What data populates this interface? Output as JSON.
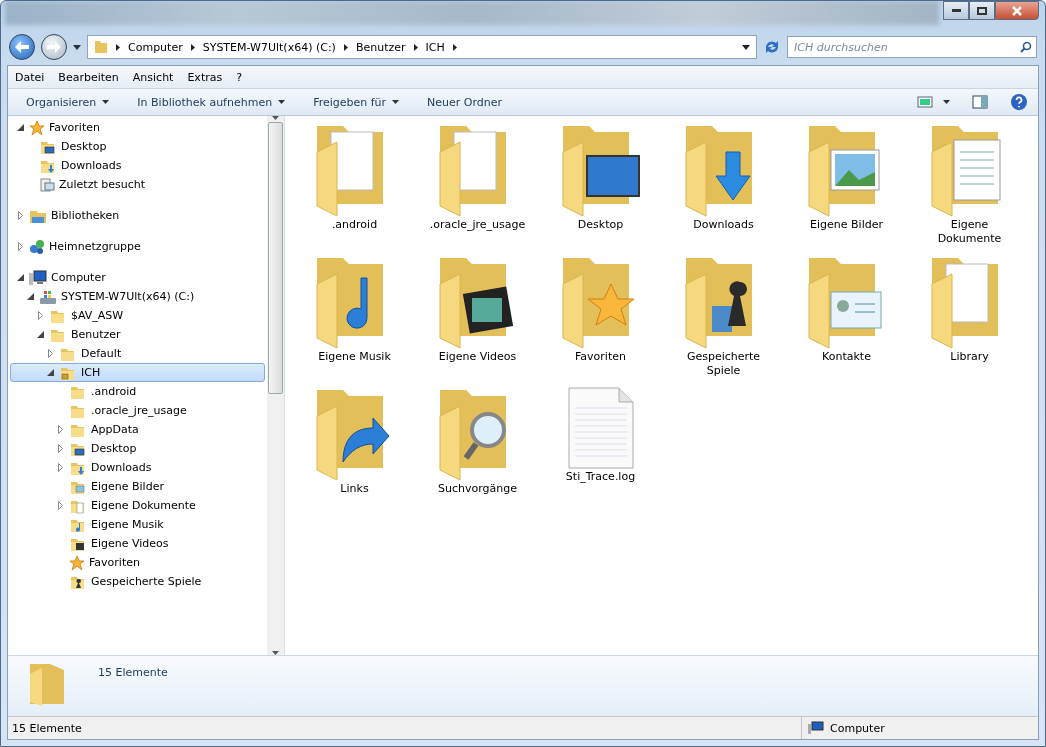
{
  "address": {
    "crumbs": [
      "Computer",
      "SYSTEM-W7Ult(x64) (C:)",
      "Benutzer",
      "ICH"
    ]
  },
  "search": {
    "placeholder": "ICH durchsuchen"
  },
  "menu": [
    "Datei",
    "Bearbeiten",
    "Ansicht",
    "Extras",
    "?"
  ],
  "commands": [
    {
      "label": "Organisieren",
      "dropdown": true
    },
    {
      "label": "In Bibliothek aufnehmen",
      "dropdown": true
    },
    {
      "label": "Freigeben für",
      "dropdown": true
    },
    {
      "label": "Neuer Ordner",
      "dropdown": false
    }
  ],
  "sidebar": {
    "items": [
      {
        "label": "Favoriten",
        "kind": "star",
        "expandable": true,
        "expanded": true,
        "selected": false,
        "children": [
          {
            "label": "Desktop",
            "kind": "monitor",
            "expandable": false,
            "selected": false
          },
          {
            "label": "Downloads",
            "kind": "download",
            "expandable": false,
            "selected": false
          },
          {
            "label": "Zuletzt besucht",
            "kind": "recent",
            "expandable": false,
            "selected": false
          }
        ]
      },
      {
        "label": "Bibliotheken",
        "kind": "library",
        "expandable": true,
        "expanded": false,
        "selected": false
      },
      {
        "label": "Heimnetzgruppe",
        "kind": "network",
        "expandable": true,
        "expanded": false,
        "selected": false
      },
      {
        "label": "Computer",
        "kind": "computer",
        "expandable": true,
        "expanded": true,
        "selected": false,
        "children": [
          {
            "label": "SYSTEM-W7Ult(x64) (C:)",
            "kind": "drive",
            "expandable": true,
            "expanded": true,
            "selected": false,
            "children": [
              {
                "label": "$AV_ASW",
                "kind": "folder",
                "expandable": true,
                "expanded": false,
                "selected": false
              },
              {
                "label": "Benutzer",
                "kind": "folder",
                "expandable": true,
                "expanded": true,
                "selected": false,
                "children": [
                  {
                    "label": "Default",
                    "kind": "folder",
                    "expandable": true,
                    "expanded": false,
                    "selected": false
                  },
                  {
                    "label": "ICH",
                    "kind": "user",
                    "expandable": true,
                    "expanded": true,
                    "selected": true,
                    "children": [
                      {
                        "label": ".android",
                        "kind": "folder",
                        "expandable": false,
                        "selected": false
                      },
                      {
                        "label": ".oracle_jre_usage",
                        "kind": "folder",
                        "expandable": false,
                        "selected": false
                      },
                      {
                        "label": "AppData",
                        "kind": "folder",
                        "expandable": true,
                        "expanded": false,
                        "selected": false
                      },
                      {
                        "label": "Desktop",
                        "kind": "monitor",
                        "expandable": true,
                        "expanded": false,
                        "selected": false
                      },
                      {
                        "label": "Downloads",
                        "kind": "download",
                        "expandable": true,
                        "expanded": false,
                        "selected": false
                      },
                      {
                        "label": "Eigene Bilder",
                        "kind": "pictures",
                        "expandable": false,
                        "selected": false
                      },
                      {
                        "label": "Eigene Dokumente",
                        "kind": "documents",
                        "expandable": true,
                        "expanded": false,
                        "selected": false
                      },
                      {
                        "label": "Eigene Musik",
                        "kind": "music",
                        "expandable": false,
                        "selected": false
                      },
                      {
                        "label": "Eigene Videos",
                        "kind": "videos",
                        "expandable": false,
                        "selected": false
                      },
                      {
                        "label": "Favoriten",
                        "kind": "star",
                        "expandable": false,
                        "selected": false
                      },
                      {
                        "label": "Gespeicherte Spiele",
                        "kind": "games",
                        "expandable": false,
                        "selected": false
                      }
                    ]
                  }
                ]
              }
            ]
          }
        ]
      }
    ]
  },
  "files": [
    {
      "label": ".android",
      "kind": "folder"
    },
    {
      "label": ".oracle_jre_usage",
      "kind": "folder"
    },
    {
      "label": "Desktop",
      "kind": "monitor"
    },
    {
      "label": "Downloads",
      "kind": "download"
    },
    {
      "label": "Eigene Bilder",
      "kind": "pictures"
    },
    {
      "label": "Eigene Dokumente",
      "kind": "documents"
    },
    {
      "label": "Eigene Musik",
      "kind": "music"
    },
    {
      "label": "Eigene Videos",
      "kind": "videos"
    },
    {
      "label": "Favoriten",
      "kind": "star"
    },
    {
      "label": "Gespeicherte Spiele",
      "kind": "games"
    },
    {
      "label": "Kontakte",
      "kind": "contacts"
    },
    {
      "label": "Library",
      "kind": "folder"
    },
    {
      "label": "Links",
      "kind": "links"
    },
    {
      "label": "Suchvorgänge",
      "kind": "search"
    },
    {
      "label": "Sti_Trace.log",
      "kind": "file"
    }
  ],
  "details": {
    "count": "15 Elemente"
  },
  "status_bar": {
    "count": "15 Elemente",
    "location": "Computer"
  }
}
